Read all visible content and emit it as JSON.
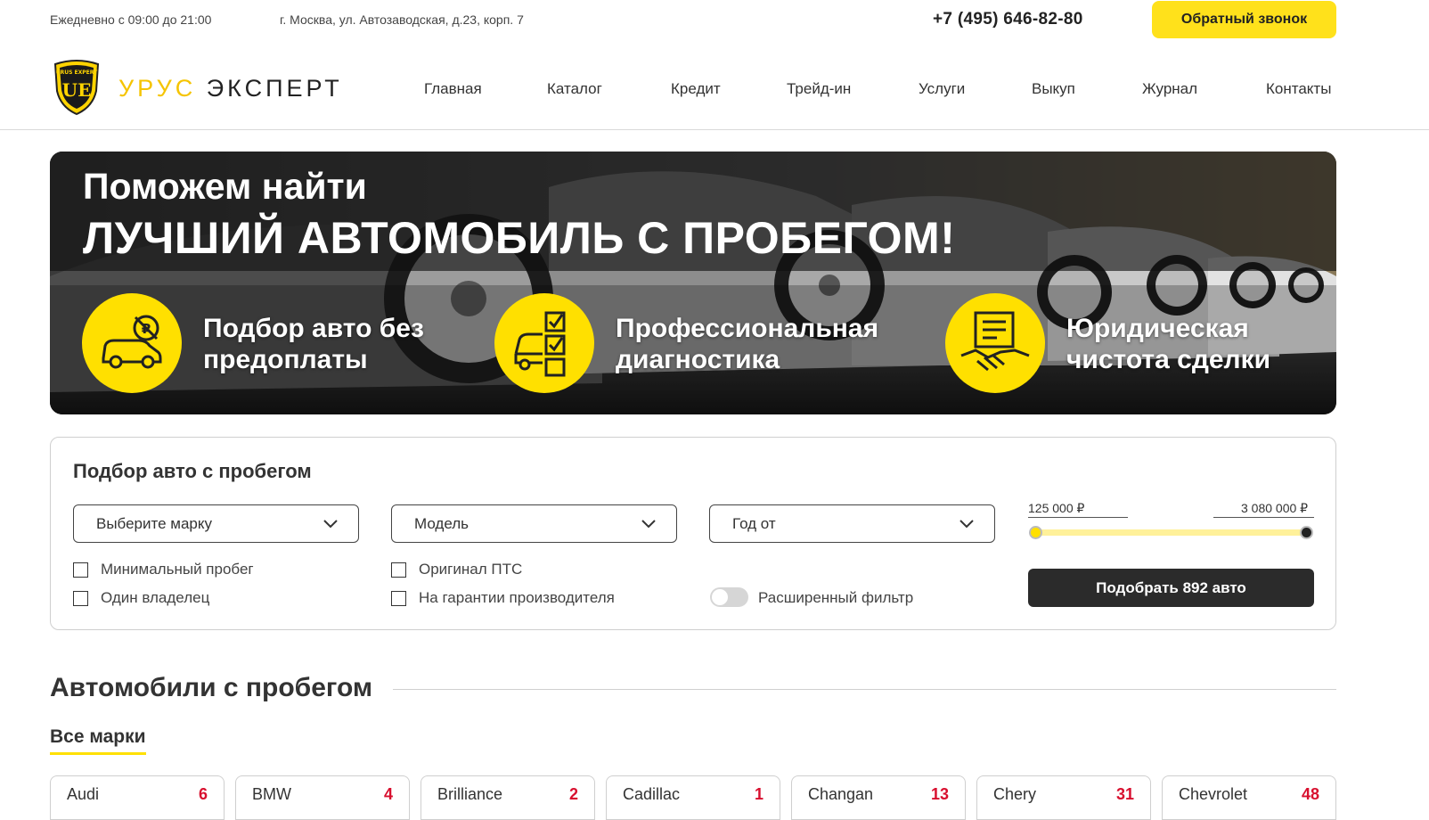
{
  "topbar": {
    "hours": "Ежедневно с 09:00 до 21:00",
    "address": "г. Москва, ул. Автозаводская, д.23, корп. 7",
    "phone": "+7 (495) 646-82-80",
    "callback_label": "Обратный звонок"
  },
  "logo": {
    "word1": "УРУС",
    "word2": "ЭКСПЕРТ",
    "badge_top": "URUS EXPERT",
    "badge_mono": "UE"
  },
  "nav": {
    "items": [
      "Главная",
      "Каталог",
      "Кредит",
      "Трейд-ин",
      "Услуги",
      "Выкуп",
      "Журнал",
      "Контакты"
    ]
  },
  "hero": {
    "line1": "Поможем найти",
    "line2": "ЛУЧШИЙ АВТОМОБИЛЬ С ПРОБЕГОМ!",
    "features": [
      {
        "line1": "Подбор авто без",
        "line2": "предоплаты",
        "icon": "car-no-prepay-icon"
      },
      {
        "line1": "Профессиональная",
        "line2": "диагностика",
        "icon": "car-checklist-icon"
      },
      {
        "line1": "Юридическая",
        "line2": "чистота сделки",
        "icon": "handshake-contract-icon"
      }
    ]
  },
  "filter": {
    "title": "Подбор авто с пробегом",
    "brand_select": "Выберите марку",
    "model_select": "Модель",
    "year_select": "Год от",
    "checkboxes": [
      "Минимальный пробег",
      "Один владелец",
      "Оригинал ПТС",
      "На гарантии производителя"
    ],
    "advanced_label": "Расширенный фильтр",
    "advanced_on": false,
    "price_min": "125 000 ₽",
    "price_max": "3 080 000 ₽",
    "submit_label": "Подобрать 892 авто"
  },
  "section": {
    "title": "Автомобили с пробегом",
    "tab_all": "Все марки"
  },
  "brands": [
    {
      "name": "Audi",
      "count": "6"
    },
    {
      "name": "BMW",
      "count": "4"
    },
    {
      "name": "Brilliance",
      "count": "2"
    },
    {
      "name": "Cadillac",
      "count": "1"
    },
    {
      "name": "Changan",
      "count": "13"
    },
    {
      "name": "Chery",
      "count": "31"
    },
    {
      "name": "Chevrolet",
      "count": "48"
    }
  ],
  "colors": {
    "accent": "#ffe11b",
    "dark": "#2b2b2b",
    "count_red": "#d80f2e"
  }
}
